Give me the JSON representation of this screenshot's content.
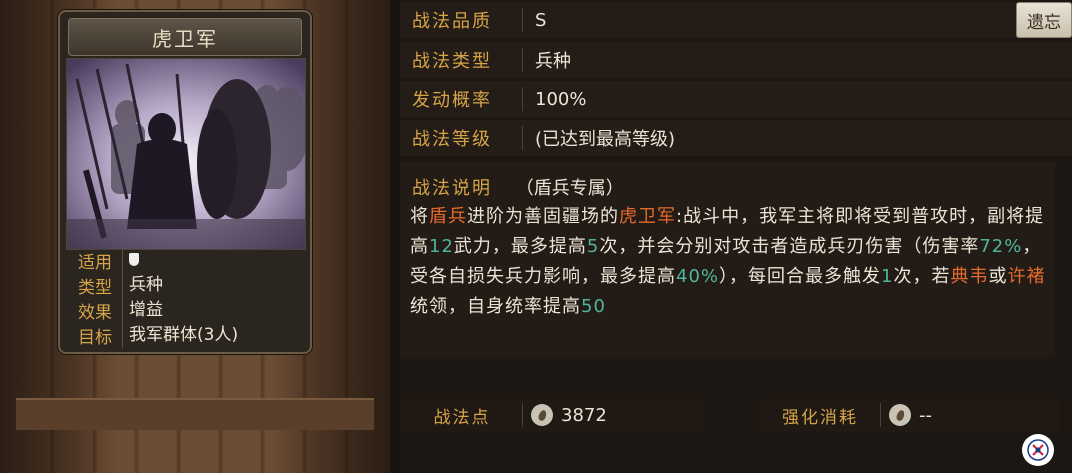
{
  "card": {
    "title": "虎卫军",
    "info": [
      {
        "key": "适用",
        "value": ""
      },
      {
        "key": "类型",
        "value": "兵种"
      },
      {
        "key": "效果",
        "value": "增益"
      },
      {
        "key": "目标",
        "value": "我军群体(3人)"
      }
    ]
  },
  "attrs": [
    {
      "key": "战法品质",
      "value": "S"
    },
    {
      "key": "战法类型",
      "value": "兵种"
    },
    {
      "key": "发动概率",
      "value": "100%"
    },
    {
      "key": "战法等级",
      "value": "(已达到最高等级)"
    }
  ],
  "description": {
    "key": "战法说明",
    "tag": "（盾兵专属）",
    "segments": [
      {
        "t": "将",
        "c": ""
      },
      {
        "t": "盾兵",
        "c": "orange"
      },
      {
        "t": "进阶为善固疆场的",
        "c": ""
      },
      {
        "t": "虎卫军",
        "c": "orange"
      },
      {
        "t": ":战斗中，我军主将即将受到普攻时，副将提高",
        "c": ""
      },
      {
        "t": "12",
        "c": "green"
      },
      {
        "t": "武力，最多提高",
        "c": ""
      },
      {
        "t": "5",
        "c": "green"
      },
      {
        "t": "次，并会分别对攻击者造成兵刃伤害（伤害率",
        "c": ""
      },
      {
        "t": "72%",
        "c": "green"
      },
      {
        "t": "，受各自损失兵力影响，最多提高",
        "c": ""
      },
      {
        "t": "40%",
        "c": "green"
      },
      {
        "t": "），每回合最多触发",
        "c": ""
      },
      {
        "t": "1",
        "c": "green"
      },
      {
        "t": "次，若",
        "c": ""
      },
      {
        "t": "典韦",
        "c": "orange"
      },
      {
        "t": "或",
        "c": ""
      },
      {
        "t": "许褚",
        "c": "orange"
      },
      {
        "t": "统领，自身统率提高",
        "c": ""
      },
      {
        "t": "50",
        "c": "green"
      }
    ]
  },
  "bottom": {
    "points_label": "战法点",
    "points_value": "3872",
    "cost_label": "强化消耗",
    "cost_value": "--"
  },
  "forget_button": "遗忘",
  "colors": {
    "gold_label": "#d7a447",
    "highlight_orange": "#e46a2b",
    "highlight_green": "#4fb59d"
  }
}
